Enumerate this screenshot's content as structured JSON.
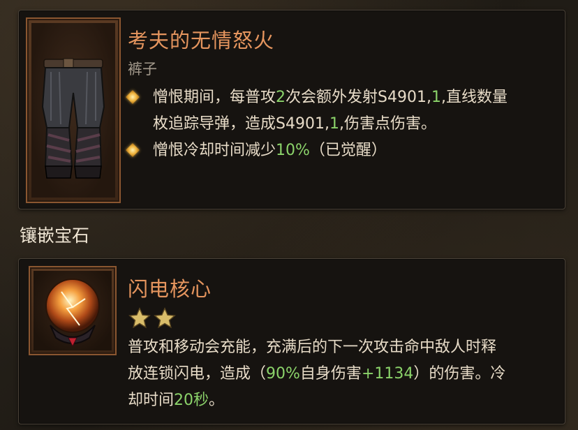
{
  "item": {
    "name": "考夫的无情怒火",
    "type": "裤子",
    "icon": "pants-icon",
    "affixes": [
      {
        "lines": [
          [
            {
              "t": "憎恨期间，每普攻"
            },
            {
              "t": "2",
              "hl": true
            },
            {
              "t": "次会额外发射S4901,"
            },
            {
              "t": "1",
              "hl": true
            },
            {
              "t": ",直线数量"
            }
          ],
          [
            {
              "t": "枚追踪导弹，造成S4901,"
            },
            {
              "t": "1",
              "hl": true
            },
            {
              "t": ",伤害点伤害。"
            }
          ]
        ]
      },
      {
        "lines": [
          [
            {
              "t": "憎恨冷却时间减少"
            },
            {
              "t": "10%",
              "hl": true
            },
            {
              "t": "（已觉醒）"
            }
          ]
        ]
      }
    ]
  },
  "gems_section": {
    "title": "镶嵌宝石"
  },
  "gem": {
    "name": "闪电核心",
    "icon": "lightning-orb-icon",
    "stars": 2,
    "description_lines": [
      [
        {
          "t": "普攻和移动会充能，充满后的下一次攻击命中敌人时释"
        }
      ],
      [
        {
          "t": "放连锁闪电，造成（"
        },
        {
          "t": "90%",
          "hl": true
        },
        {
          "t": "自身伤害"
        },
        {
          "t": "+1134",
          "hl": true
        },
        {
          "t": "）的伤害。冷"
        }
      ],
      [
        {
          "t": "却时间"
        },
        {
          "t": "20秒",
          "hl": true
        },
        {
          "t": "。"
        }
      ]
    ]
  },
  "colors": {
    "title": "#e5955e",
    "highlight": "#8bd36a",
    "text": "#e8dcc8",
    "subtext": "#a39a8c",
    "frame": "#8a5630"
  }
}
